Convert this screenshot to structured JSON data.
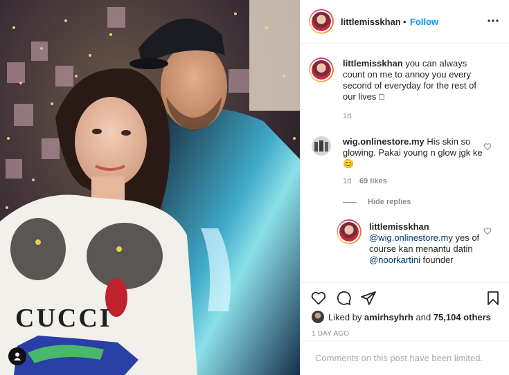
{
  "header": {
    "username": "littlemisskhan",
    "separator": "•",
    "follow_label": "Follow"
  },
  "caption": {
    "username": "littlemisskhan",
    "text": "you can always count on me to annoy you every second of everyday for the rest of our lives □",
    "time": "1d"
  },
  "comments": [
    {
      "username": "wig.onlinestore.my",
      "text": "His skin so glowing. Pakai young n glow jgk ke 😊",
      "time": "1d",
      "likes": "69 likes",
      "hide_replies": "Hide replies",
      "replies": [
        {
          "username": "littlemisskhan",
          "mention1": "@wig.onlinestore.my",
          "text1": "yes of course kan menantu datin",
          "mention2": "@noorkartini",
          "text2": "founder"
        }
      ]
    }
  ],
  "likes": {
    "prefix": "Liked by",
    "user": "amirhsyhrh",
    "and": "and",
    "count": "75,104 others"
  },
  "post_time": "1 DAY AGO",
  "footer": {
    "text": "Comments on this post have been limited."
  },
  "icons": [
    "heart-icon",
    "comment-icon",
    "share-icon",
    "bookmark-icon",
    "more-icon",
    "user-tag-icon"
  ]
}
